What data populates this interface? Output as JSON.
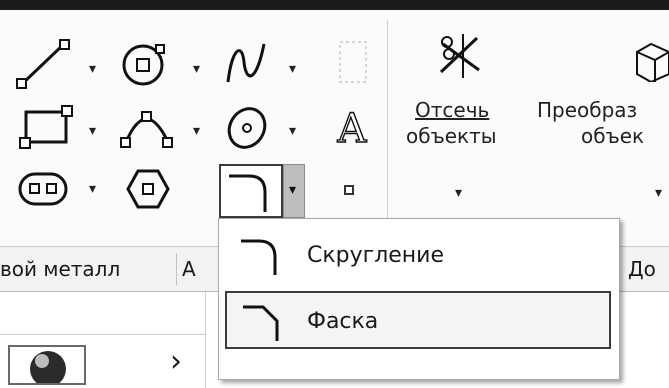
{
  "ribbon": {
    "trim": {
      "line1": "Отсечь",
      "line2": "объекты"
    },
    "convert": {
      "line1": "Преобраз",
      "line2": "объек"
    },
    "text_tool_glyph": "A"
  },
  "tabs": [
    "вой металл",
    "А",
    "До"
  ],
  "menu": {
    "items": [
      {
        "label": "Скругление",
        "icon": "fillet-icon",
        "highlighted": false
      },
      {
        "label": "Фаска",
        "icon": "chamfer-icon",
        "highlighted": true
      }
    ]
  },
  "nav": {
    "chevron": "›"
  },
  "colors": {
    "top_rule": "#1b1b1b",
    "highlight_border": "#3a3a3a",
    "split_arrow_bg": "#bdbdbd"
  }
}
